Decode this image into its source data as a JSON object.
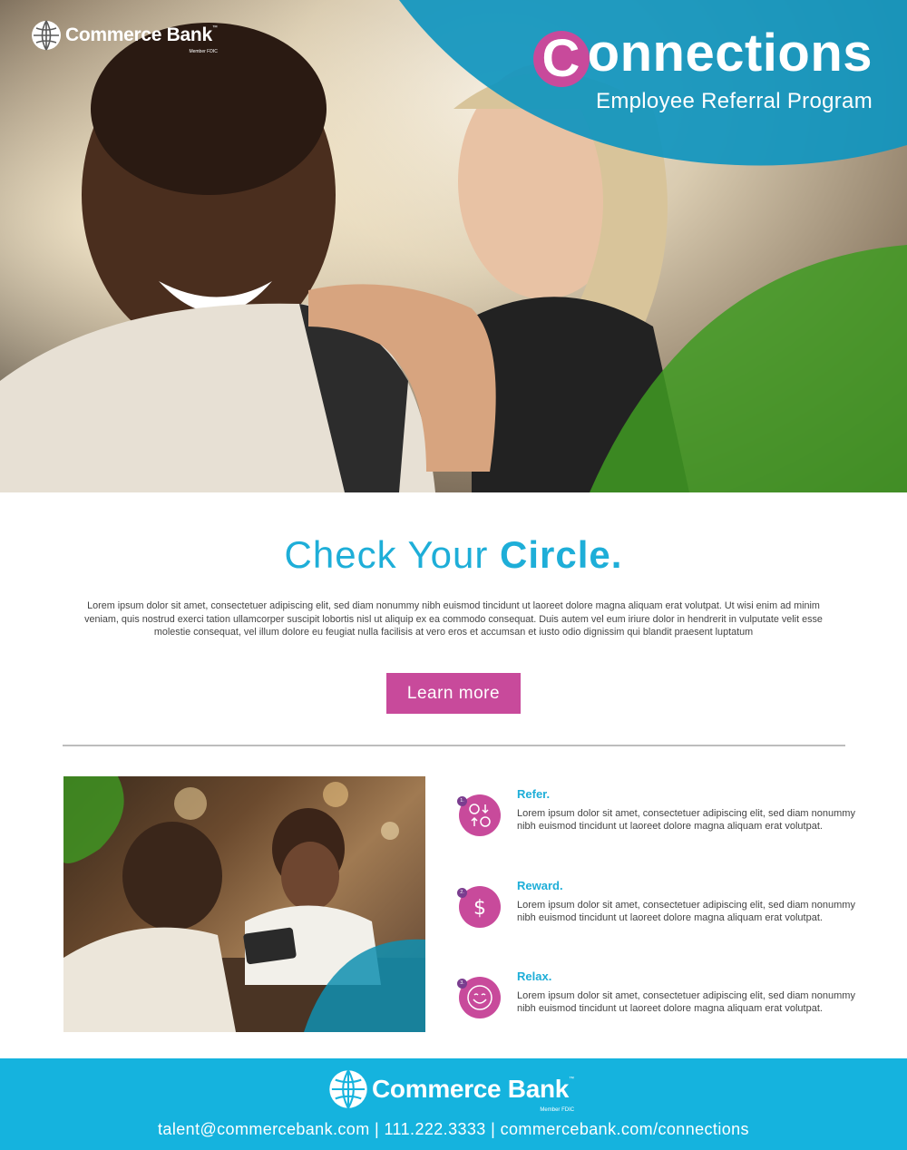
{
  "brand": {
    "name": "Commerce Bank",
    "trademark": "™",
    "member": "Member FDIC"
  },
  "hero": {
    "title_initial": "C",
    "title_rest": "onnections",
    "subtitle": "Employee Referral Program"
  },
  "intro": {
    "headline_light": "Check Your ",
    "headline_bold": "Circle.",
    "body": "Lorem ipsum dolor sit amet, consectetuer adipiscing elit, sed diam nonummy nibh euismod tincidunt ut laoreet dolore magna aliquam erat volutpat. Ut wisi enim ad minim veniam, quis nostrud exerci tation ullamcorper suscipit lobortis nisl ut aliquip ex ea commodo consequat. Duis autem vel eum iriure dolor in hendrerit in vulputate velit esse molestie consequat, vel illum dolore eu feugiat nulla facilisis at vero eros et accumsan et iusto odio dignissim qui blandit praesent luptatum",
    "button_label": "Learn more"
  },
  "steps": [
    {
      "num": "1.",
      "title": "Refer.",
      "icon": "refer-exchange-icon",
      "body": "Lorem ipsum dolor sit amet, consectetuer adipiscing elit, sed diam nonummy nibh euismod tincidunt ut laoreet dolore magna aliquam erat volutpat."
    },
    {
      "num": "2.",
      "title": "Reward.",
      "icon": "dollar-icon",
      "body": "Lorem ipsum dolor sit amet, consectetuer adipiscing elit, sed diam nonummy nibh euismod tincidunt ut laoreet dolore magna aliquam erat volutpat."
    },
    {
      "num": "3.",
      "title": "Relax.",
      "icon": "smiley-icon",
      "body": "Lorem ipsum dolor sit amet, consectetuer adipiscing elit, sed diam nonummy nibh euismod tincidunt ut laoreet dolore magna aliquam erat volutpat."
    }
  ],
  "footer": {
    "email": "talent@commercebank.com",
    "separator": "|",
    "phone": "111.222.3333",
    "url": "commercebank.com/connections"
  },
  "colors": {
    "magenta": "#c84a9b",
    "cyan": "#1eaed8",
    "teal": "#0f8fb0",
    "green": "#3f8f2a",
    "footer": "#15b3de"
  }
}
